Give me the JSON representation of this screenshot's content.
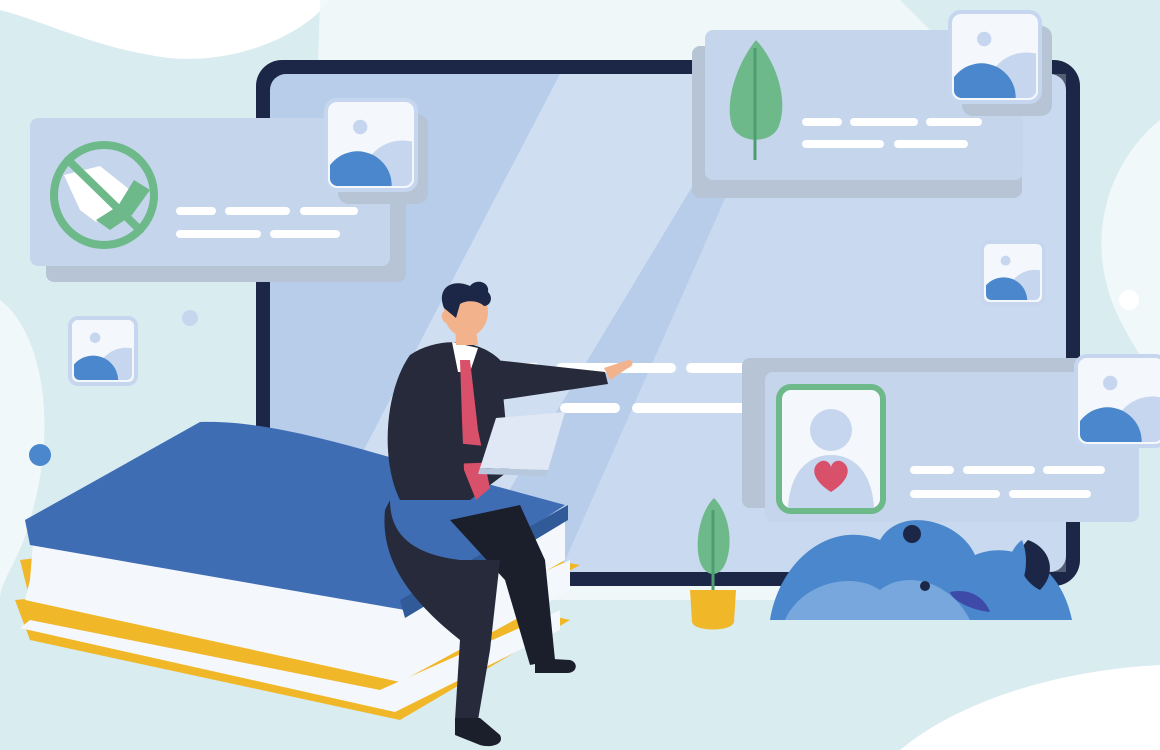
{
  "scene": {
    "name": "person-presenting-dashboard-illustration"
  },
  "palette": {
    "background": "#d9ecf0",
    "blob_white": "#ffffff",
    "blob_light": "#f1f8fa",
    "monitor_frame": "#1c2747",
    "monitor_screen": "#b7cdea",
    "card": "#c5d5ec",
    "card_shadow": "#b7c4d6",
    "card_line": "#ffffff",
    "thumb_bg": "#f4f7fb",
    "thumb_blue": "#4a87cc",
    "thumb_light": "#c6d6ee",
    "green": "#6db98a",
    "green_dark": "#4e9d70",
    "heart": "#d9506b",
    "book_blue": "#3f6db3",
    "book_blue_dark": "#315a99",
    "book_yellow": "#f0b728",
    "book_pages": "#f4f7fb",
    "suit": "#262a3a",
    "suit_dark": "#1b1e2b",
    "tie": "#d9506b",
    "skin": "#f2b38c",
    "hair": "#1c2747",
    "pot": "#f0b728",
    "bush_blue": "#4a87cc",
    "bush_light": "#77a7dc",
    "bush_dark": "#1c2747"
  },
  "icons": {
    "handshake_card": "handshake-icon",
    "tree_card": "leaf-tree-icon",
    "profile_card": "user-heart-icon",
    "thumbnail": "image-placeholder-icon"
  }
}
